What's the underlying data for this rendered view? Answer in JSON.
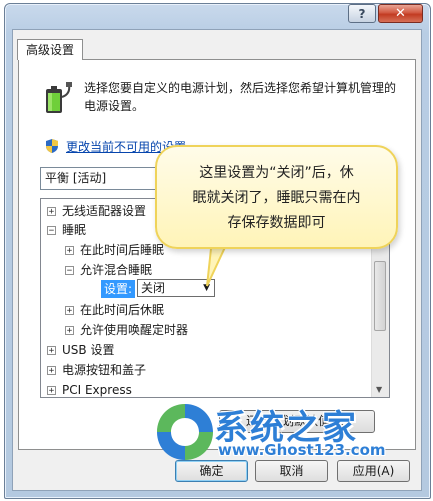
{
  "window": {
    "help_glyph": "?",
    "close_glyph": "✕"
  },
  "tab": {
    "label": "高级设置"
  },
  "description": {
    "text": "选择您要自定义的电源计划，然后选择您希望计算机管理的电源设置。"
  },
  "unavailable_link": {
    "label": "更改当前不可用的设置"
  },
  "plan_select": {
    "value": "平衡 [活动]"
  },
  "tree": {
    "rows": [
      {
        "label": "无线适配器设置",
        "expander": "+",
        "indent": 0
      },
      {
        "label": "睡眠",
        "expander": "−",
        "indent": 0
      },
      {
        "label": "在此时间后睡眠",
        "expander": "+",
        "indent": 1
      },
      {
        "label": "允许混合睡眠",
        "expander": "−",
        "indent": 1
      },
      {
        "label": "在此时间后休眠",
        "expander": "+",
        "indent": 1
      },
      {
        "label": "允许使用唤醒定时器",
        "expander": "+",
        "indent": 1
      },
      {
        "label": "USB 设置",
        "expander": "+",
        "indent": 0
      },
      {
        "label": "电源按钮和盖子",
        "expander": "+",
        "indent": 0
      },
      {
        "label": "PCI Express",
        "expander": "+",
        "indent": 0
      }
    ],
    "setting": {
      "label": "设置:",
      "value": "关闭"
    }
  },
  "restore_button": {
    "label": "还原计划默认值(R)"
  },
  "buttons": {
    "ok": "确定",
    "cancel": "取消",
    "apply": "应用(A)"
  },
  "callout": {
    "line1": "这里设置为“关闭”后，休",
    "line2": "眠就关闭了，睡眠只需在内",
    "line3": "存保存数据即可"
  },
  "watermark": {
    "name": "系统之家",
    "url": "www.Ghost123.com"
  },
  "colors": {
    "link": "#0645ad",
    "selection": "#3399ff",
    "callout_border": "#efd35a",
    "watermark": "#2e7fd6"
  }
}
